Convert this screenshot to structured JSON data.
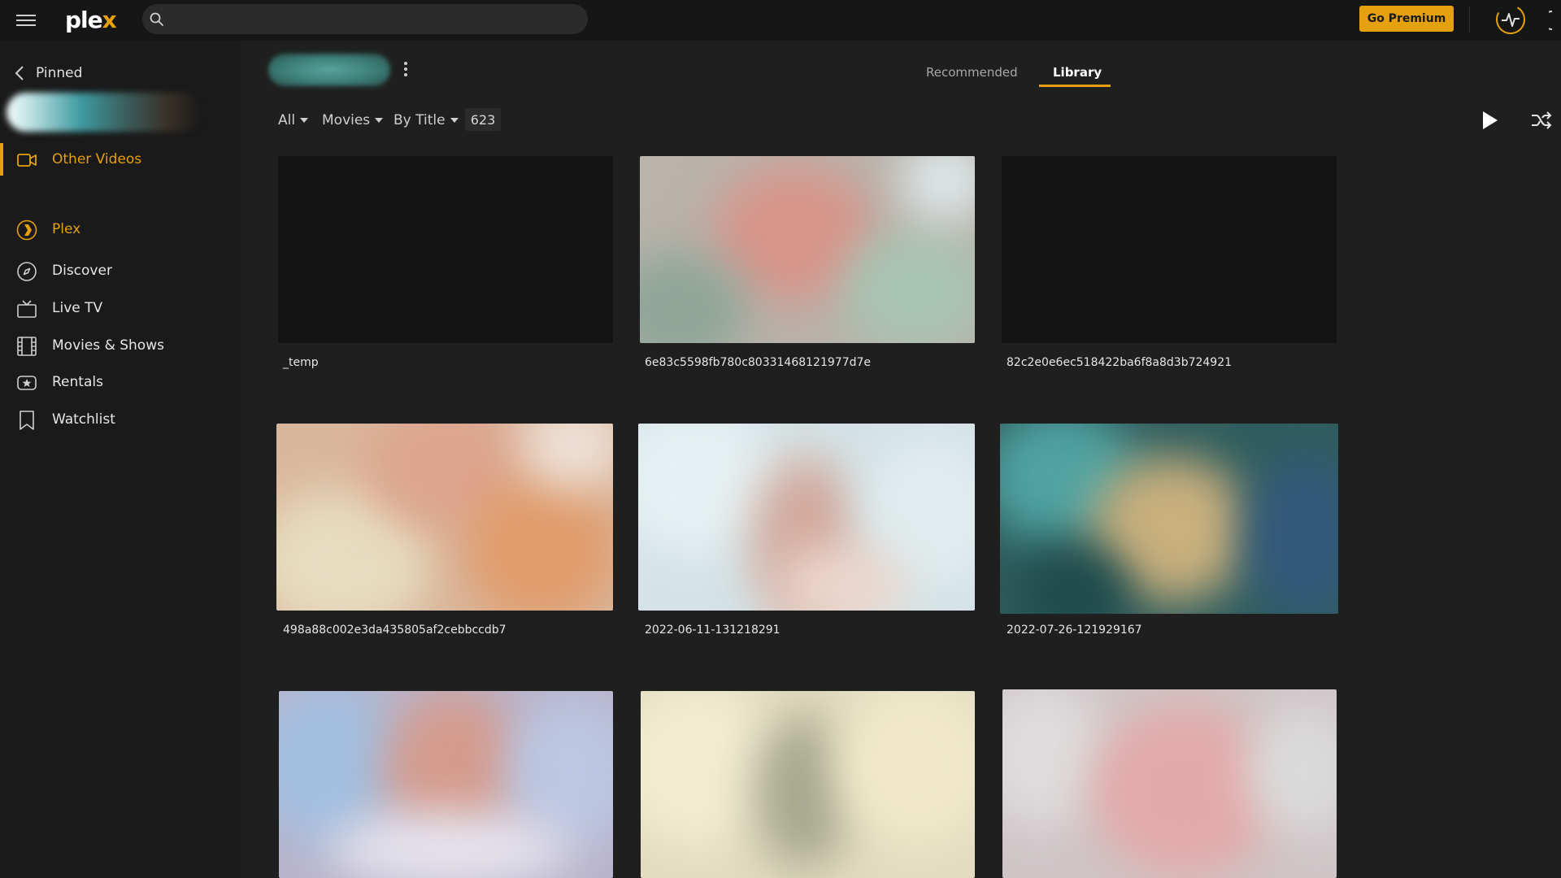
{
  "app": {
    "logo_main": "ple",
    "logo_x": "x"
  },
  "search": {
    "placeholder": ""
  },
  "header": {
    "premium_label": "Go Premium"
  },
  "sidebar": {
    "pinned_label": "Pinned",
    "items": [
      {
        "label": "Other Videos",
        "icon": "video-camera-icon",
        "active": true
      },
      {
        "label": "Plex",
        "icon": "plex-chevron-icon"
      },
      {
        "label": "Discover",
        "icon": "compass-icon"
      },
      {
        "label": "Live TV",
        "icon": "tv-icon"
      },
      {
        "label": "Movies & Shows",
        "icon": "film-icon"
      },
      {
        "label": "Rentals",
        "icon": "rentals-star-icon"
      },
      {
        "label": "Watchlist",
        "icon": "bookmark-icon"
      }
    ]
  },
  "tabs": {
    "recommended": "Recommended",
    "library": "Library",
    "active": "Library"
  },
  "filters": {
    "type": "All",
    "kind": "Movies",
    "sort": "By Title",
    "count": "623"
  },
  "grid": {
    "items": [
      {
        "title": "_temp"
      },
      {
        "title": "6e83c5598fb780c80331468121977d7e"
      },
      {
        "title": "82c2e0e6ec518422ba6f8a8d3b724921"
      },
      {
        "title": "498a88c002e3da435805af2cebbccdb7"
      },
      {
        "title": "2022-06-11-131218291"
      },
      {
        "title": "2022-07-26-121929167"
      },
      {
        "title": ""
      },
      {
        "title": ""
      },
      {
        "title": ""
      }
    ]
  },
  "colors": {
    "accent": "#e5a00d",
    "background": "#1f1f1f",
    "sidebar": "#1a1a1a",
    "topbar": "#161616"
  }
}
